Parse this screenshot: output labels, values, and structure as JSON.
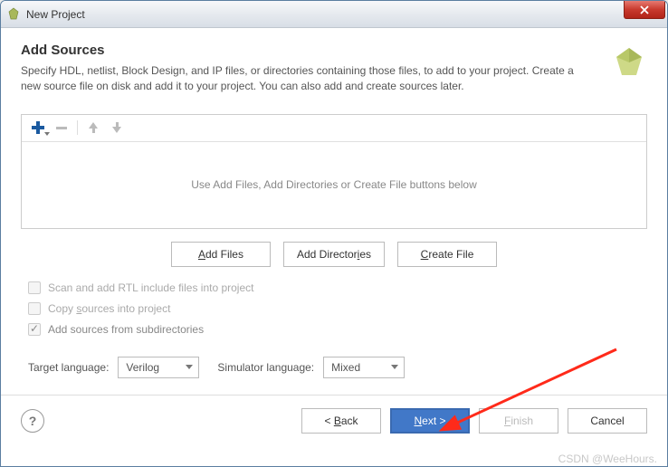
{
  "titlebar": {
    "title": "New Project"
  },
  "header": {
    "title": "Add Sources",
    "description": "Specify HDL, netlist, Block Design, and IP files, or directories containing those files, to add to your project. Create a new source file on disk and add it to your project. You can also add and create sources later."
  },
  "list": {
    "placeholder": "Use Add Files, Add Directories or Create File buttons below"
  },
  "actions": {
    "add_files": {
      "pre": "",
      "u": "A",
      "post": "dd Files"
    },
    "add_dirs": {
      "pre": "Add Director",
      "u": "i",
      "post": "es"
    },
    "create_file": {
      "pre": "",
      "u": "C",
      "post": "reate File"
    }
  },
  "checkboxes": {
    "scan": "Scan and add RTL include files into project",
    "copy": {
      "pre": "Copy ",
      "u": "s",
      "post": "ources into project"
    },
    "subdirs": "Add sources from subdirectories"
  },
  "language": {
    "target_label": "Target language:",
    "target_value": "Verilog",
    "sim_label": "Simulator language:",
    "sim_value": "Mixed"
  },
  "footer": {
    "back": {
      "pre": "< ",
      "u": "B",
      "post": "ack"
    },
    "next": {
      "pre": "",
      "u": "N",
      "post": "ext >"
    },
    "finish": {
      "pre": "",
      "u": "F",
      "post": "inish"
    },
    "cancel": "Cancel",
    "help": "?"
  },
  "watermark": "CSDN @WeeHours."
}
